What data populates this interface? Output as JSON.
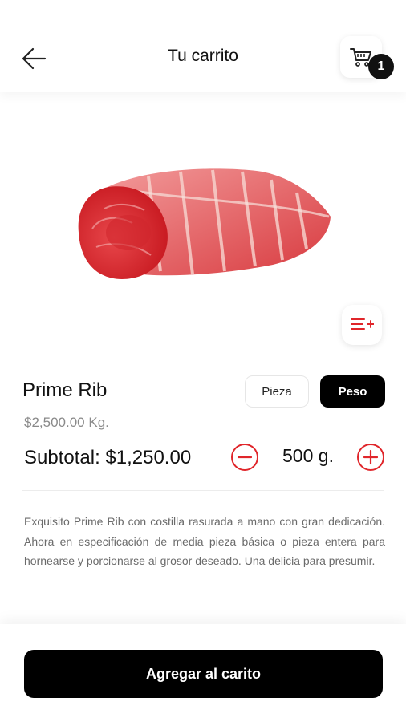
{
  "header": {
    "title": "Tu carrito",
    "back_icon": "arrow-left-icon",
    "cart_icon": "shopping-cart-icon",
    "cart_count": "1"
  },
  "product": {
    "image": "prime-rib-meat-image",
    "name": "Prime Rib",
    "price": "$2,500.00 Kg.",
    "subtotal": "Subtotal: $1,250.00",
    "quantity": "500 g.",
    "description": "Exquisito Prime Rib con costilla rasurada a mano con gran dedicación. Ahora en especificación de media pieza básica o pieza entera para hornearse y porcionarse al grosor deseado. Una delicia para presumir."
  },
  "unit_toggle": {
    "options": [
      "Pieza",
      "Peso"
    ],
    "selected": "Peso"
  },
  "actions": {
    "add_label": "Agregar al carito"
  },
  "colors": {
    "accent": "#e0262b",
    "primary": "#000000",
    "muted_text": "#8a8a8a"
  }
}
